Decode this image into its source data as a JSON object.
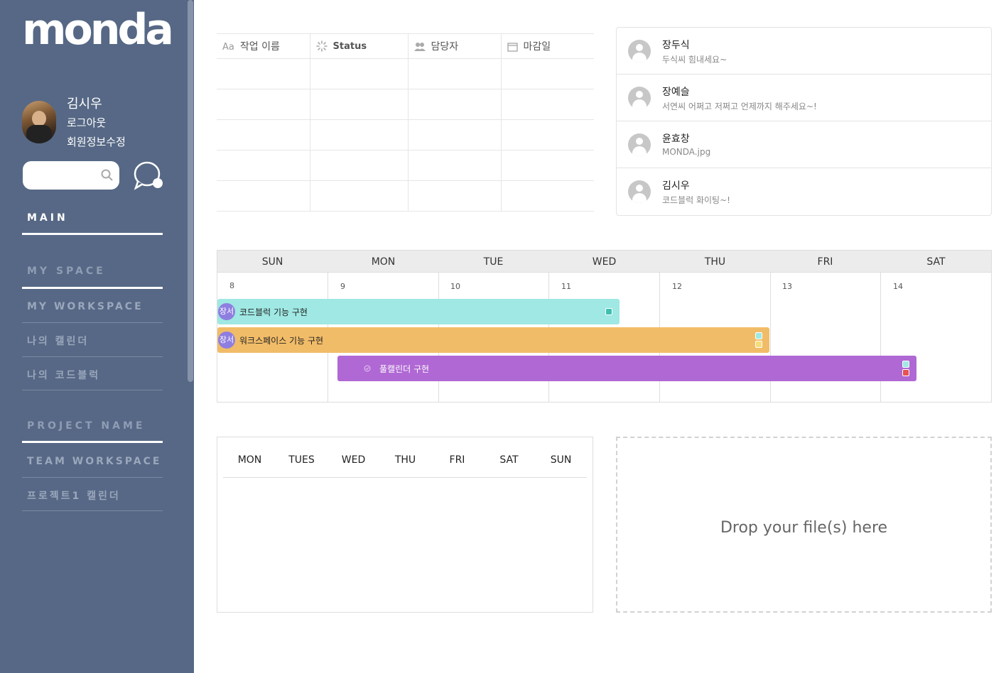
{
  "sidebar": {
    "logo": "monda",
    "user_name": "김시우",
    "logout": "로그아웃",
    "edit_profile": "회원정보수정",
    "search_placeholder": "",
    "main": "MAIN",
    "my_space": "MY SPACE",
    "my_workspace": "MY WORKSPACE",
    "my_items": [
      "나의 캘린더",
      "나의 코드블럭"
    ],
    "project_name": "PROJECT NAME",
    "team_workspace": "TEAM WORKSPACE",
    "team_items": [
      "프로젝트1 캘린더"
    ]
  },
  "task_table": {
    "columns": [
      {
        "icon": "text-type-icon",
        "glyph": "Aa",
        "label": "작업 이름"
      },
      {
        "icon": "status-loader-icon",
        "glyph": "",
        "label": "Status"
      },
      {
        "icon": "people-icon",
        "glyph": "",
        "label": "담당자"
      },
      {
        "icon": "calendar-icon",
        "glyph": "",
        "label": "마감일"
      }
    ],
    "row_count": 5
  },
  "comments": [
    {
      "name": "장두식",
      "message": "두식씨 힘내세요~"
    },
    {
      "name": "장예슬",
      "message": "서연씨 어쩌고 저쩌고 언제까지 해주세요~!"
    },
    {
      "name": "윤효창",
      "message": "MONDA.jpg"
    },
    {
      "name": "김시우",
      "message": "코드블럭 화이팅~!"
    }
  ],
  "calendar": {
    "days": [
      "SUN",
      "MON",
      "TUE",
      "WED",
      "THU",
      "FRI",
      "SAT"
    ],
    "dates": [
      "8",
      "9",
      "10",
      "11",
      "12",
      "13",
      "14"
    ],
    "events": [
      {
        "badge": "장서",
        "title": "코드블럭 기능 구현",
        "color": "#9fe8e3"
      },
      {
        "badge": "장서",
        "title": "워크스페이스 기능 구현",
        "color": "#f1bc68"
      },
      {
        "badge": "",
        "title": "풀캘린더 구현",
        "color": "#b068d4"
      }
    ]
  },
  "week": {
    "days": [
      "MON",
      "TUES",
      "WED",
      "THU",
      "FRI",
      "SAT",
      "SUN"
    ]
  },
  "dropzone": {
    "text": "Drop your file(s) here"
  }
}
